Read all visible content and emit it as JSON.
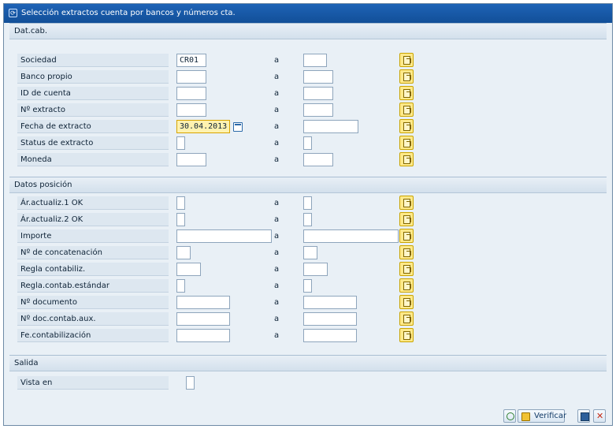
{
  "window": {
    "title": "Selección extractos cuenta por bancos y números cta."
  },
  "groups": {
    "header": {
      "title": "Dat.cab.",
      "rows": [
        {
          "label": "Sociedad",
          "from": "CR01",
          "to_label": "a",
          "to": ""
        },
        {
          "label": "Banco propio",
          "from": "",
          "to_label": "a",
          "to": ""
        },
        {
          "label": "ID de cuenta",
          "from": "",
          "to_label": "a",
          "to": ""
        },
        {
          "label": "Nº extracto",
          "from": "",
          "to_label": "a",
          "to": ""
        },
        {
          "label": "Fecha de extracto",
          "from": "30.04.2013",
          "to_label": "a",
          "to": ""
        },
        {
          "label": "Status de extracto",
          "from": "",
          "to_label": "a",
          "to": ""
        },
        {
          "label": "Moneda",
          "from": "",
          "to_label": "a",
          "to": ""
        }
      ]
    },
    "position": {
      "title": "Datos posición",
      "rows": [
        {
          "label": "Ár.actualiz.1 OK",
          "from": "",
          "to_label": "a",
          "to": ""
        },
        {
          "label": "Ár.actualiz.2 OK",
          "from": "",
          "to_label": "a",
          "to": ""
        },
        {
          "label": "Importe",
          "from": "",
          "to_label": "a",
          "to": ""
        },
        {
          "label": "Nº de concatenación",
          "from": "",
          "to_label": "a",
          "to": ""
        },
        {
          "label": "Regla contabiliz.",
          "from": "",
          "to_label": "a",
          "to": ""
        },
        {
          "label": "Regla.contab.estándar",
          "from": "",
          "to_label": "a",
          "to": ""
        },
        {
          "label": "Nº documento",
          "from": "",
          "to_label": "a",
          "to": ""
        },
        {
          "label": "Nº doc.contab.aux.",
          "from": "",
          "to_label": "a",
          "to": ""
        },
        {
          "label": "Fe.contabilización",
          "from": "",
          "to_label": "a",
          "to": ""
        }
      ]
    },
    "output": {
      "title": "Salida",
      "rows": [
        {
          "label": "Vista en",
          "value": ""
        }
      ]
    }
  },
  "footer": {
    "verify_label": "Verificar"
  },
  "icons": {
    "title": "window-icon",
    "multiple_selection": "multiple-selection-icon",
    "calendar": "calendar-icon",
    "execute": "execute-icon",
    "verify": "verify-icon",
    "save": "save-icon",
    "cancel": "cancel-icon"
  },
  "colors": {
    "title_bar": "#124f98",
    "focus_field": "#fff2b0",
    "selection_button": "#ffe98a"
  }
}
